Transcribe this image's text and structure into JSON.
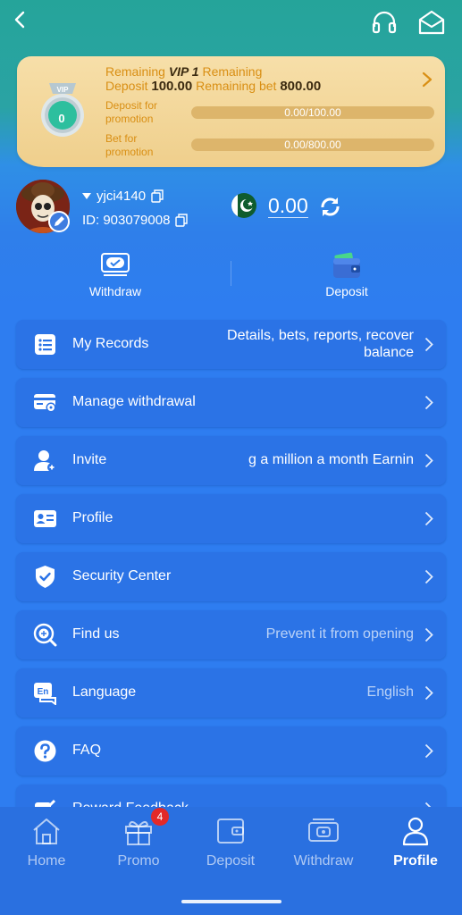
{
  "vip": {
    "line1_prefix": "Remaining",
    "level_name": "VIP 1",
    "line1_suffix": "Remaining",
    "deposit_label": "Deposit",
    "deposit_remaining": "100.00",
    "bet_label": "Remaining bet",
    "bet_remaining": "800.00",
    "badge_level": "0",
    "badge_text": "VIP",
    "deposit_progress_label": "Deposit for promotion",
    "deposit_progress_text": "0.00/100.00",
    "deposit_progress_fraction": 0,
    "bet_progress_label": "Bet for promotion",
    "bet_progress_text": "0.00/800.00",
    "bet_progress_fraction": 0
  },
  "user": {
    "username": "yjci4140",
    "id_text": "ID: 903079008",
    "balance": "0.00",
    "currency_flag": "pakistan-flag"
  },
  "quick_actions": {
    "withdraw": "Withdraw",
    "deposit": "Deposit"
  },
  "menu": {
    "items": [
      {
        "label": "My Records",
        "value": "Details, bets, reports, recover balance",
        "icon": "records-icon"
      },
      {
        "label": "Manage withdrawal",
        "value": "",
        "icon": "card-settings-icon"
      },
      {
        "label": "Invite",
        "value": "g a million a month  Earnin",
        "icon": "invite-icon"
      },
      {
        "label": "Profile",
        "value": "",
        "icon": "id-card-icon"
      },
      {
        "label": "Security Center",
        "value": "",
        "icon": "shield-check-icon"
      },
      {
        "label": "Find us",
        "value": "Prevent it from opening",
        "icon": "find-us-icon"
      },
      {
        "label": "Language",
        "value": "English",
        "icon": "language-icon"
      },
      {
        "label": "FAQ",
        "value": "",
        "icon": "question-icon"
      },
      {
        "label": "Reward Feedback",
        "value": "",
        "icon": "feedback-icon"
      }
    ]
  },
  "nav": {
    "items": [
      {
        "label": "Home",
        "icon": "home-icon"
      },
      {
        "label": "Promo",
        "icon": "gift-icon",
        "badge": "4"
      },
      {
        "label": "Deposit",
        "icon": "wallet-icon"
      },
      {
        "label": "Withdraw",
        "icon": "withdraw-icon"
      },
      {
        "label": "Profile",
        "icon": "person-icon"
      }
    ],
    "active": "Profile"
  },
  "colors": {
    "background": "#2e7df0",
    "header_teal": "#25a49a",
    "vip_gold": "#d98f14",
    "card": "#2b73e6",
    "badge_red": "#e22929"
  }
}
